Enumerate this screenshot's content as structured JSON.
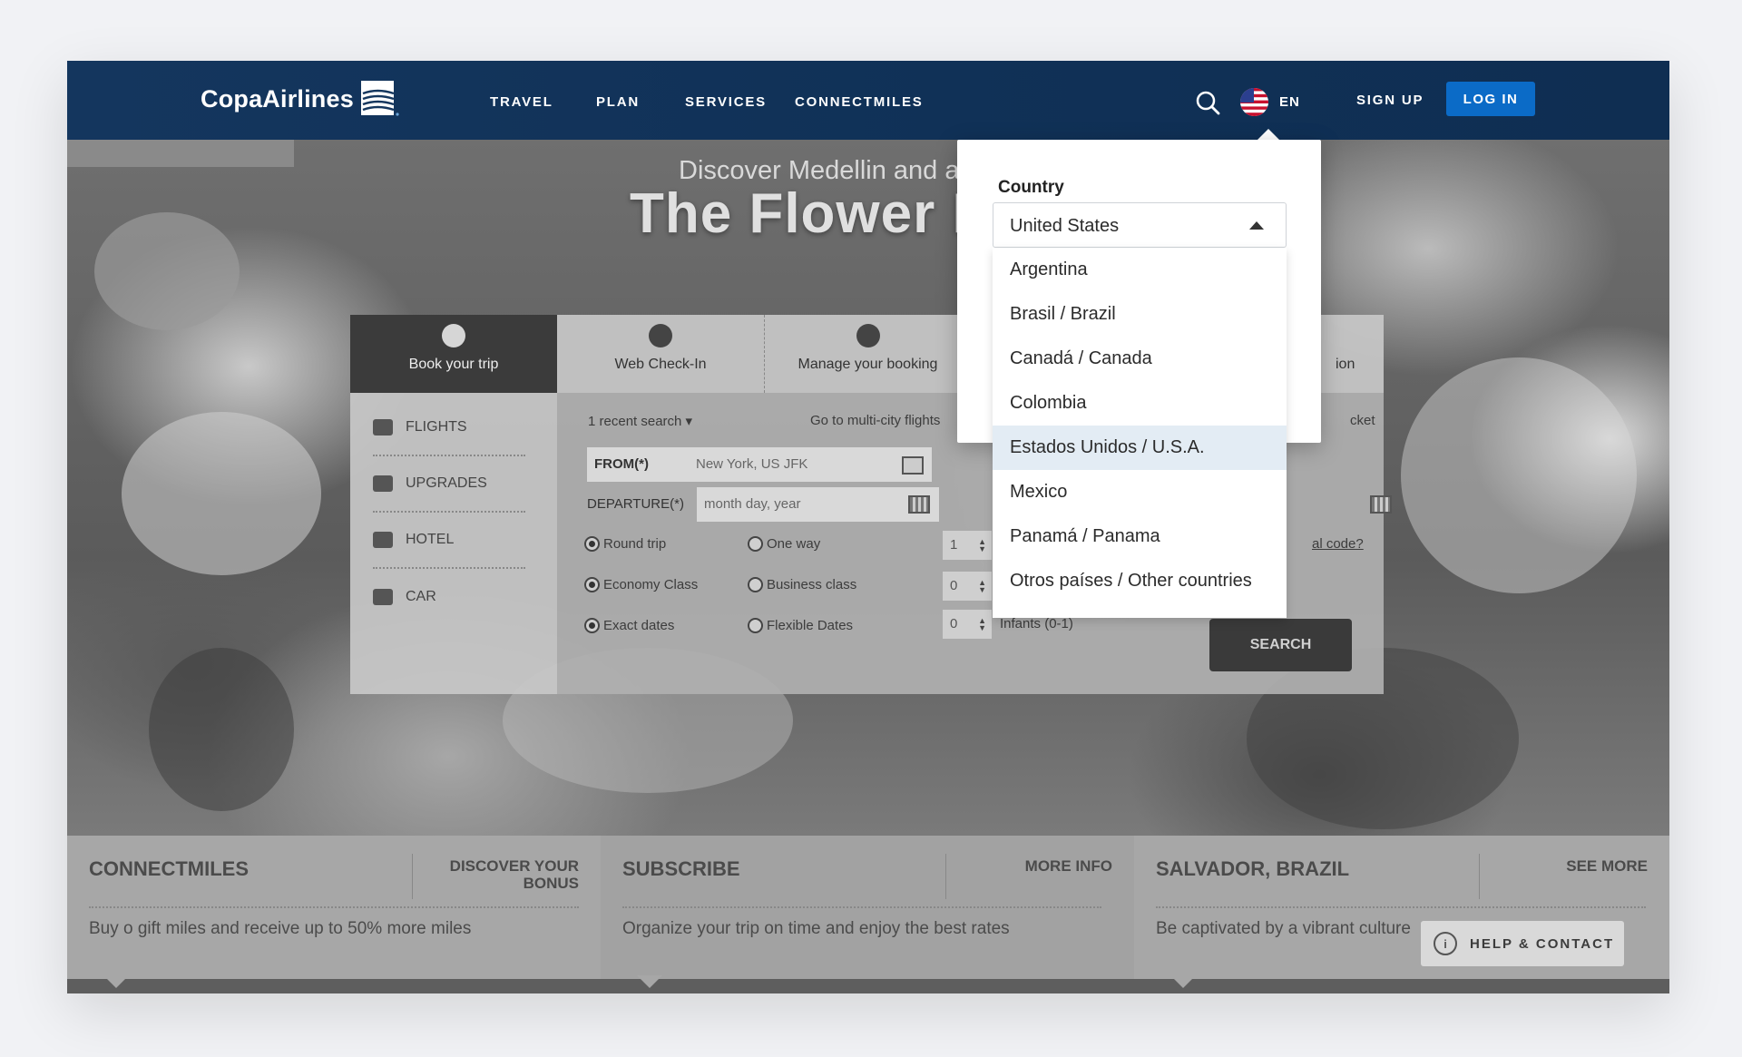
{
  "brand": {
    "name": "CopaAirlines"
  },
  "nav": {
    "travel": "TRAVEL",
    "plan": "PLAN",
    "services": "SERVICES",
    "connectmiles": "CONNECTMILES",
    "language": "EN",
    "signup": "SIGN UP",
    "login": "LOG IN"
  },
  "hero": {
    "subtitle": "Discover Medellin and a",
    "title": "The Flower F"
  },
  "booking": {
    "tabs": {
      "book": "Book your trip",
      "checkin": "Web Check-In",
      "manage": "Manage your booking",
      "right_partial": "ion"
    },
    "side": {
      "flights": "FLIGHTS",
      "upgrades": "UPGRADES",
      "hotel": "HOTEL",
      "car": "CAR"
    },
    "recent_search": "1 recent search ▾",
    "multicity": "Go to multi-city flights",
    "ticket_partial": "cket",
    "from_label": "FROM(*)",
    "from_value": "New York, US JFK",
    "departure_label": "DEPARTURE(*)",
    "departure_placeholder": "month day, year",
    "trip_types": {
      "round": "Round trip",
      "oneway": "One way"
    },
    "cabins": {
      "economy": "Economy Class",
      "business": "Business class"
    },
    "dates": {
      "exact": "Exact dates",
      "flexible": "Flexible Dates"
    },
    "adults": "1",
    "children": "0",
    "infants": "0",
    "infants_label": "Infants (0-1)",
    "promo_partial": "al code?",
    "search": "SEARCH"
  },
  "cards": [
    {
      "title": "CONNECTMILES",
      "link": "DISCOVER YOUR BONUS",
      "text": "Buy o gift miles and receive up to 50% more miles"
    },
    {
      "title": "SUBSCRIBE",
      "link": "MORE INFO",
      "text": "Organize your trip on time and enjoy the best rates"
    },
    {
      "title": "SALVADOR, BRAZIL",
      "link": "SEE MORE",
      "text": "Be captivated by a vibrant culture"
    }
  ],
  "help": {
    "label": "HELP & CONTACT"
  },
  "country_picker": {
    "label": "Country",
    "selected": "United States",
    "options": [
      "Argentina",
      "Brasil / Brazil",
      "Canadá / Canada",
      "Colombia",
      "Estados Unidos / U.S.A.",
      "Mexico",
      "Panamá / Panama",
      "Otros países / Other countries"
    ],
    "highlighted_index": 4
  },
  "colors": {
    "header": "#14365e",
    "login_button": "#0b6bc7",
    "highlight": "#e3ecf4"
  }
}
